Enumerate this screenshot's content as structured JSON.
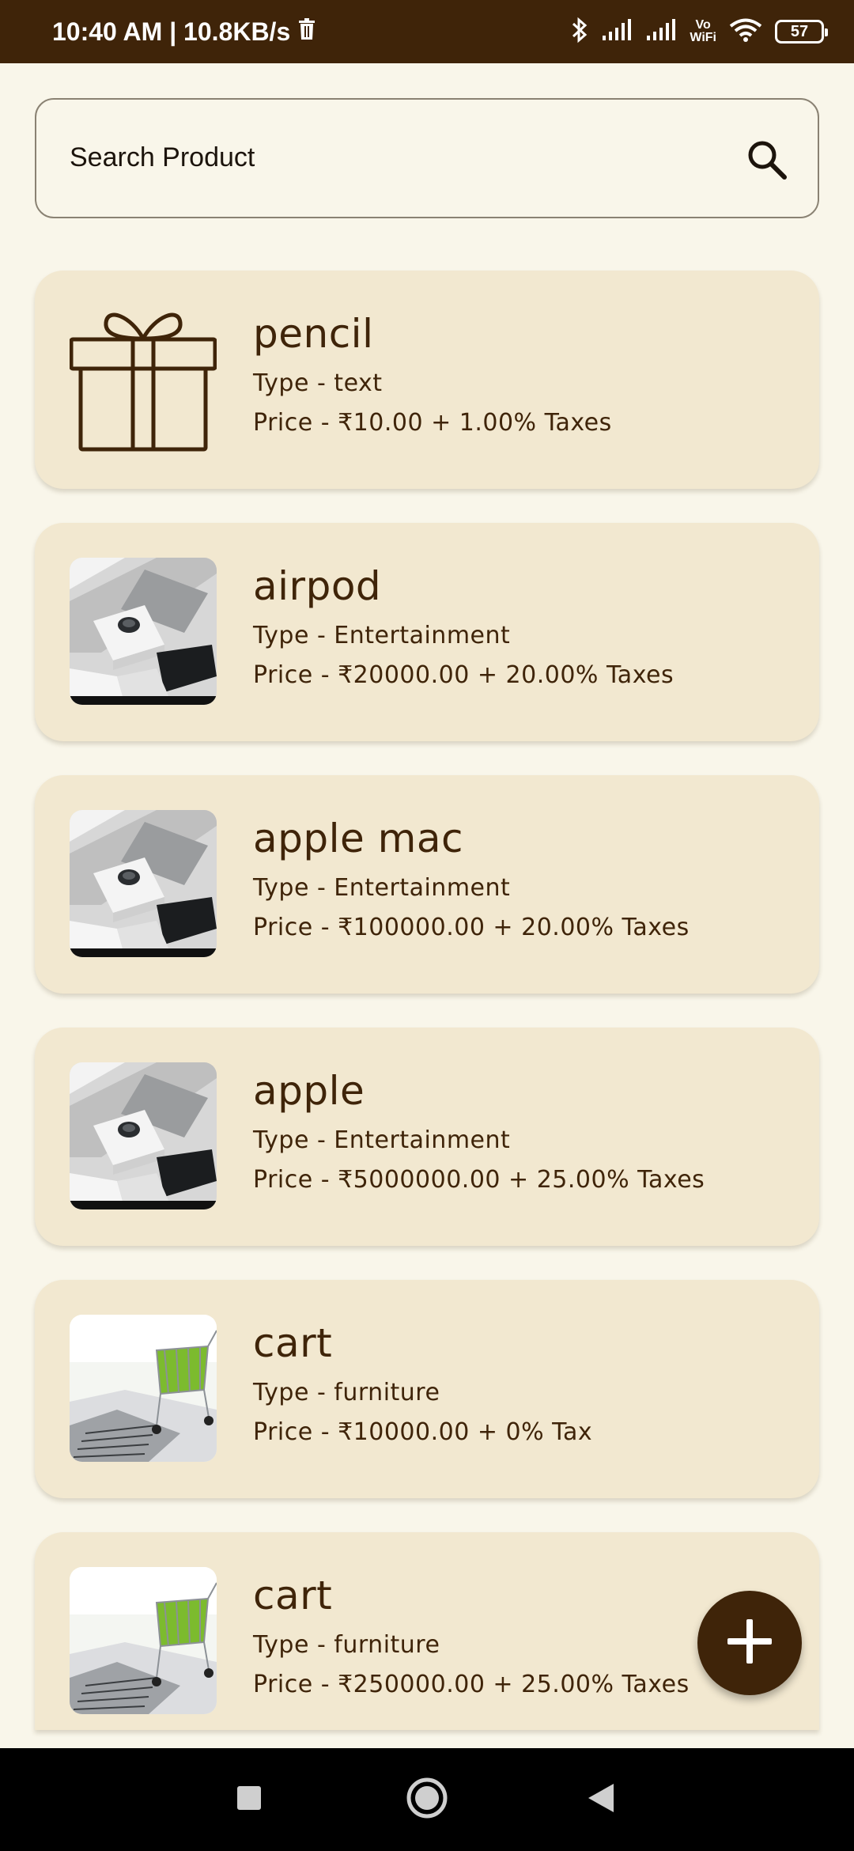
{
  "status_bar": {
    "time_speed": "10:40 AM | 10.8KB/s",
    "vowifi_top": "Vo",
    "vowifi_bottom": "WiFi",
    "battery": "57",
    "icons": [
      "trash-icon",
      "bluetooth-icon",
      "signal-icon",
      "signal-icon",
      "wifi-icon",
      "battery-icon"
    ]
  },
  "search": {
    "placeholder": "Search Product",
    "icon": "search-icon"
  },
  "products": [
    {
      "name": "pencil",
      "type": "Type - text",
      "price": "Price - ₹10.00 + 1.00% Taxes",
      "thumb": "gift-icon"
    },
    {
      "name": "airpod",
      "type": "Type - Entertainment",
      "price": "Price - ₹20000.00 + 20.00% Taxes",
      "thumb": "product-photo-devices"
    },
    {
      "name": "apple mac",
      "type": "Type - Entertainment",
      "price": "Price - ₹100000.00 + 20.00% Taxes",
      "thumb": "product-photo-devices"
    },
    {
      "name": "apple",
      "type": "Type - Entertainment",
      "price": "Price - ₹5000000.00 + 25.00% Taxes",
      "thumb": "product-photo-devices"
    },
    {
      "name": "cart",
      "type": "Type - furniture",
      "price": "Price - ₹10000.00 + 0% Tax",
      "thumb": "product-photo-cart"
    },
    {
      "name": "cart",
      "type": "Type - furniture",
      "price": "Price - ₹250000.00 + 25.00% Taxes",
      "thumb": "product-photo-cart"
    }
  ],
  "fab": {
    "icon": "plus-icon"
  },
  "nav_bar": {
    "icons": [
      "recents-square-icon",
      "home-circle-icon",
      "back-triangle-icon"
    ]
  },
  "colors": {
    "primary": "#3f2409",
    "background": "#f9f6ea",
    "card": "#f2e8d0",
    "nav": "#000000"
  }
}
